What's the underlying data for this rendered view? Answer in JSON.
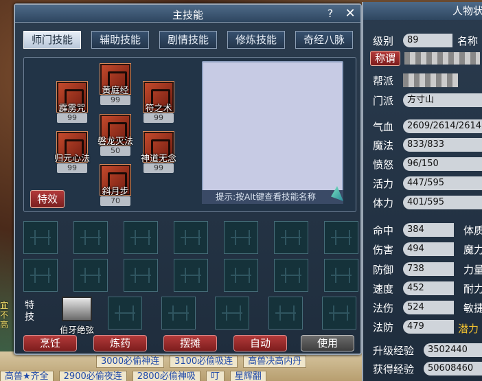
{
  "main_panel": {
    "title": "主技能",
    "help": "?",
    "close": "✕",
    "tabs": [
      "师门技能",
      "辅助技能",
      "剧情技能",
      "修炼技能",
      "奇经八脉"
    ],
    "skills": [
      {
        "name": "黄庭经",
        "level": "99"
      },
      {
        "name": "霹雳咒",
        "level": "99"
      },
      {
        "name": "符之术",
        "level": "99"
      },
      {
        "name": "磐龙灭法",
        "level": "50"
      },
      {
        "name": "归元心法",
        "level": "99"
      },
      {
        "name": "神道无念",
        "level": "99"
      },
      {
        "name": "斜月步",
        "level": "70"
      }
    ],
    "effect_button": "特效",
    "hint": "提示:按Alt键查看技能名称",
    "special_label": "特技",
    "special_skill": "伯牙绝弦",
    "actions": [
      "烹饪",
      "炼药",
      "摆摊",
      "自动",
      "使用"
    ]
  },
  "character_panel": {
    "title": "人物状",
    "level_label": "级别",
    "level": "89",
    "name_label": "名称",
    "title_button": "称谓",
    "guild_label": "帮派",
    "sect_label": "门派",
    "sect": "方寸山",
    "stats": [
      {
        "label": "气血",
        "value": "2609/2614/2614"
      },
      {
        "label": "魔法",
        "value": "833/833"
      },
      {
        "label": "愤怒",
        "value": "96/150"
      },
      {
        "label": "活力",
        "value": "447/595"
      },
      {
        "label": "体力",
        "value": "401/595"
      }
    ],
    "attrs": [
      {
        "label": "命中",
        "value": "384",
        "right": "体质"
      },
      {
        "label": "伤害",
        "value": "494",
        "right": "魔力"
      },
      {
        "label": "防御",
        "value": "738",
        "right": "力量"
      },
      {
        "label": "速度",
        "value": "452",
        "right": "耐力"
      },
      {
        "label": "法伤",
        "value": "524",
        "right": "敏捷"
      },
      {
        "label": "法防",
        "value": "479",
        "right": "潜力"
      }
    ],
    "exp_up_label": "升级经验",
    "exp_up": "3502440",
    "exp_got_label": "获得经验",
    "exp_got": "50608460"
  },
  "background": {
    "side_text": "宜不高",
    "banner_row1": [
      "3000必偷神连",
      "3100必偷吸连",
      "高兽决高内丹"
    ],
    "banner_row2": [
      "高兽★齐全",
      "2900必偷夜连",
      "2800必偷神吸",
      "叮",
      "星辉翻"
    ]
  }
}
